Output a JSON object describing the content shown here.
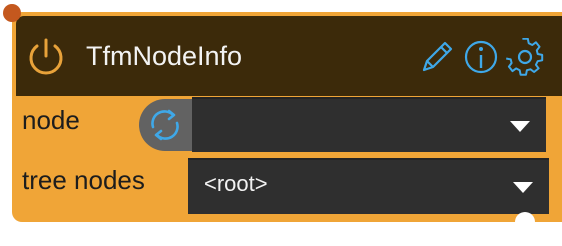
{
  "node": {
    "title": "TfmNodeInfo",
    "rows": [
      {
        "label": "node",
        "value": ""
      },
      {
        "label": "tree nodes",
        "value": "<root>"
      }
    ]
  },
  "icons": {
    "power": "power-icon",
    "edit": "pencil-icon",
    "info": "info-icon",
    "settings": "gear-icon",
    "refresh": "refresh-icon",
    "dropdown": "caret-down-icon"
  },
  "colors": {
    "node_body": "#f0a537",
    "header": "#3c2a0a",
    "accent_icon": "#3fa8e8",
    "dropdown": "#2f2f2f"
  }
}
